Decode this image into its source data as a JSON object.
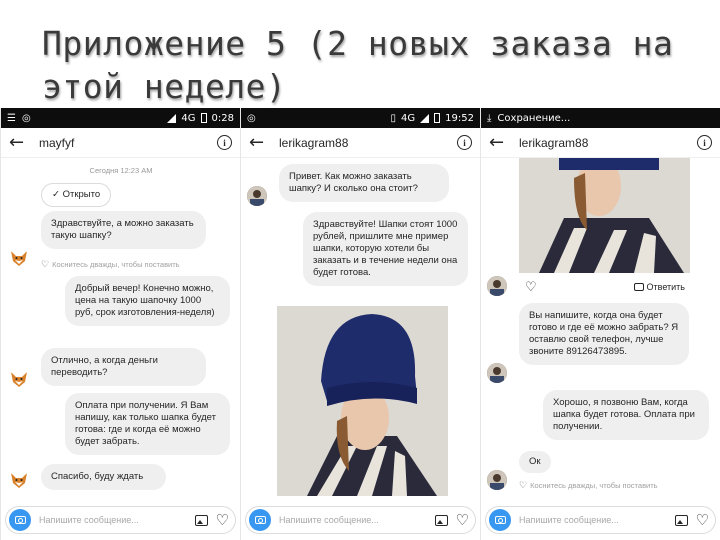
{
  "slide": {
    "title": "Приложение 5 (2 новых заказа на этой неделе)"
  },
  "phone1": {
    "status_time": "0:28",
    "network": "4G",
    "username": "mayfyf",
    "timestamp": "Сегодня 12:23 AM",
    "opened_chip": "Открыто",
    "messages": [
      "Здравствуйте, а можно заказать такую шапку?",
      "Добрый вечер! Конечно можно, цена на такую шапочку 1000 руб, срок изготовления-неделя)",
      "Отлично, а когда деньги переводить?",
      "Оплата при получении. Я Вам напишу, как только шапка будет готова: где и когда её можно будет забрать.",
      "Спасибо, буду ждать"
    ],
    "double_tap_hint": "Коснитесь дважды, чтобы поставить",
    "composer_placeholder": "Напишите сообщение..."
  },
  "phone2": {
    "status_time": "19:52",
    "network": "4G",
    "username": "lerikagram88",
    "messages": [
      "Привет. Как можно заказать шапку? И сколько она стоит?",
      "Здравствуйте! Шапки стоят 1000 рублей, пришлите мне пример шапки, которую хотели бы заказать и в течение недели она будет готова."
    ],
    "composer_placeholder": "Напишите сообщение..."
  },
  "phone3": {
    "status_text": "Сохранение...",
    "username": "lerikagram88",
    "reply_label": "Ответить",
    "messages": [
      "Вы напишите, когда она будет готово и где её можно забрать? Я оставлю свой телефон, лучше звоните 89126473895.",
      "Хорошо, я позвоню Вам, когда шапка будет готова. Оплата при получении.",
      "Ок"
    ],
    "double_tap_hint": "Коснитесь дважды, чтобы поставить",
    "composer_placeholder": "Напишите сообщение..."
  },
  "colors": {
    "accent": "#3897f0",
    "bubble": "#efefef",
    "hat": "#1f2c6b"
  }
}
